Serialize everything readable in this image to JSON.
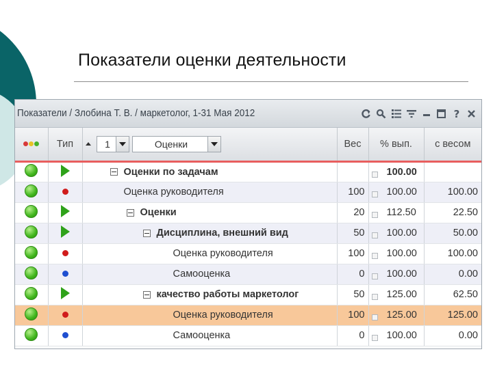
{
  "slide": {
    "title": "Показатели оценки деятельности"
  },
  "panel": {
    "title": "Показатели / Злобина Т. В. / маркетолог, 1-31 Мая 2012",
    "tools": [
      "refresh-icon",
      "settings-icon",
      "list-icon",
      "filter-icon",
      "minimize-icon",
      "restore-icon",
      "help-icon",
      "close-icon"
    ]
  },
  "columns": {
    "type": "Тип",
    "level_value": "1",
    "name_filter": "Оценки",
    "weight": "Вес",
    "pct_done": "% вып.",
    "weighted": "с весом"
  },
  "colors": {
    "status_green": "#41b61d",
    "header_accent": "#e85e5e",
    "selected_row": "#f8c89a"
  },
  "rows": [
    {
      "type": "group",
      "name": "Оценки по задачам",
      "weight": "",
      "pct": "100.00",
      "weighted": ""
    },
    {
      "type": "red",
      "name": "Оценка руководителя",
      "weight": "100",
      "pct": "100.00",
      "weighted": "100.00"
    },
    {
      "type": "group",
      "name": "Оценки",
      "weight": "20",
      "pct": "112.50",
      "weighted": "22.50"
    },
    {
      "type": "group",
      "name": "Дисциплина, внешний вид",
      "weight": "50",
      "pct": "100.00",
      "weighted": "50.00"
    },
    {
      "type": "red",
      "name": "Оценка руководителя",
      "weight": "100",
      "pct": "100.00",
      "weighted": "100.00"
    },
    {
      "type": "blue",
      "name": "Самооценка",
      "weight": "0",
      "pct": "100.00",
      "weighted": "0.00"
    },
    {
      "type": "group",
      "name": "качество работы маркетолог",
      "weight": "50",
      "pct": "125.00",
      "weighted": "62.50"
    },
    {
      "type": "red",
      "name": "Оценка руководителя",
      "weight": "100",
      "pct": "125.00",
      "weighted": "125.00"
    },
    {
      "type": "blue",
      "name": "Самооценка",
      "weight": "0",
      "pct": "100.00",
      "weighted": "0.00"
    }
  ]
}
